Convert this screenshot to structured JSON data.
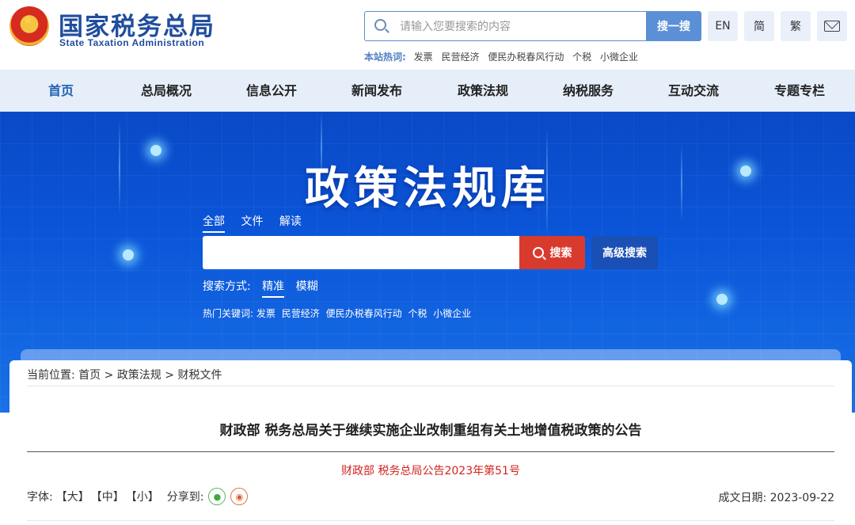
{
  "header": {
    "logo_cn": "国家税务总局",
    "logo_en": "State Taxation Administration",
    "search_placeholder": "请输入您要搜索的内容",
    "search_button": "搜一搜",
    "lang_en": "EN",
    "lang_simplified": "简",
    "lang_traditional": "繁",
    "hot_label": "本站热词:",
    "hot_words": [
      "发票",
      "民营经济",
      "便民办税春风行动",
      "个税",
      "小微企业"
    ]
  },
  "nav": {
    "items": [
      "首页",
      "总局概况",
      "信息公开",
      "新闻发布",
      "政策法规",
      "纳税服务",
      "互动交流",
      "专题专栏"
    ],
    "active_index": 0
  },
  "banner": {
    "title": "政策法规库",
    "scope_tabs": [
      "全部",
      "文件",
      "解读"
    ],
    "search_button": "搜索",
    "advanced_button": "高级搜索",
    "mode_label": "搜索方式:",
    "mode_options": [
      "精准",
      "模糊"
    ],
    "hot_label": "热门关键词:",
    "hot_words": [
      "发票",
      "民营经济",
      "便民办税春风行动",
      "个税",
      "小微企业"
    ]
  },
  "content": {
    "breadcrumb_label": "当前位置:",
    "breadcrumb": [
      "首页",
      "政策法规",
      "财税文件"
    ],
    "breadcrumb_sep": ">",
    "title": "财政部 税务总局关于继续实施企业改制重组有关土地增值税政策的公告",
    "doc_number": "财政部 税务总局公告2023年第51号",
    "font_label": "字体:",
    "font_sizes": [
      "【大】",
      "【中】",
      "【小】"
    ],
    "share_label": "分享到:",
    "date_label": "成文日期:",
    "date": "2023-09-22"
  },
  "colors": {
    "brand_blue": "#1f4d9e",
    "nav_bg": "#e6eef9",
    "banner_blue": "#0b55d8",
    "search_red": "#d93a2e",
    "doc_number_red": "#d3231f"
  }
}
